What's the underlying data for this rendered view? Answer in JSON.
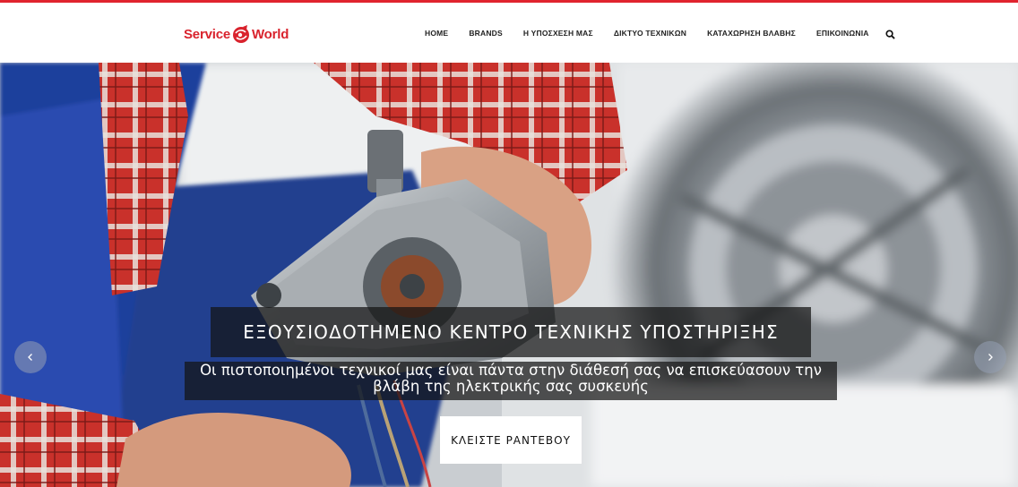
{
  "brand": {
    "logo_left": "Service",
    "logo_right": "World",
    "accent_color": "#e0232e"
  },
  "nav": {
    "items": [
      {
        "label": "HOME"
      },
      {
        "label": "BRANDS"
      },
      {
        "label": "Η ΥΠΟΣΧΕΣΗ ΜΑΣ"
      },
      {
        "label": "ΔΙΚΤΥΟ ΤΕΧΝΙΚΩΝ"
      },
      {
        "label": "ΚΑΤΑΧΩΡΗΣΗ ΒΛΑΒΗΣ"
      },
      {
        "label": "ΕΠΙΚΟΙΝΩΝΙΑ"
      }
    ],
    "search_icon": "search-icon"
  },
  "hero": {
    "title": "ΕΞΟΥΣΙΟΔΟΤΗΜΕΝΟ ΚΕΝΤΡΟ ΤΕΧΝΙΚΗΣ ΥΠΟΣΤΗΡΙΞΗΣ",
    "subtitle": "Οι πιστοποιημένοι τεχνικοί μας είναι πάντα στην διάθεσή σας να επισκεύασουν την βλάβη της ηλεκτρικής σας συσκευής",
    "cta_label": "ΚΛΕΙΣΤΕ ΡΑΝΤΕΒΟΥ",
    "prev_icon": "chevron-left-icon",
    "next_icon": "chevron-right-icon"
  }
}
